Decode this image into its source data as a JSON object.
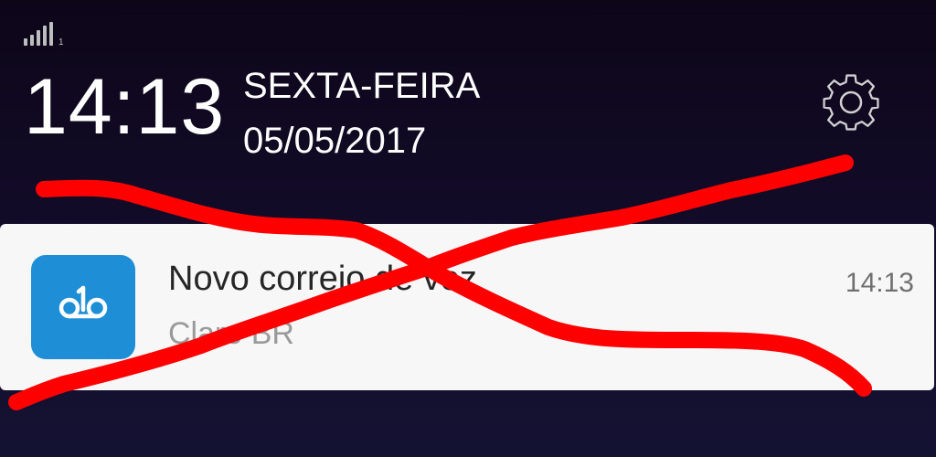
{
  "status_bar": {
    "sim_label": "1",
    "signal_icon": "signal-strength-icon"
  },
  "header": {
    "time": "14:13",
    "day": "SEXTA-FEIRA",
    "date": "05/05/2017",
    "settings_icon": "gear-icon"
  },
  "notification": {
    "title": "Novo correio de voz",
    "subtitle": "Claro BR",
    "time": "14:13",
    "app_icon": "voicemail-icon",
    "app_icon_color": "#1e8fd6"
  },
  "overlay": {
    "type": "red-x-scribble",
    "color": "#ff0000"
  }
}
